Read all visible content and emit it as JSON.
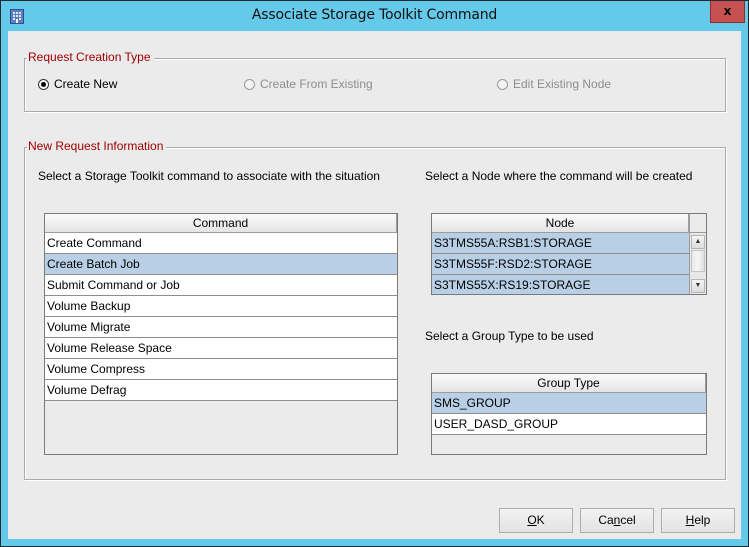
{
  "window": {
    "title": "Associate Storage Toolkit Command",
    "icon": "building-icon",
    "close_label": "x"
  },
  "request_creation_type": {
    "legend": "Request Creation Type",
    "options": [
      {
        "label": "Create New",
        "selected": true,
        "enabled": true
      },
      {
        "label": "Create From Existing",
        "selected": false,
        "enabled": false
      },
      {
        "label": "Edit Existing Node",
        "selected": false,
        "enabled": false
      }
    ]
  },
  "new_request_information": {
    "legend": "New Request Information",
    "command_prompt": "Select a Storage Toolkit command to associate with the situation",
    "node_prompt": "Select a Node where the command will be created",
    "group_prompt": "Select a Group Type to be used",
    "command_table": {
      "header": "Command",
      "rows": [
        {
          "label": "Create Command",
          "selected": false
        },
        {
          "label": "Create Batch Job",
          "selected": true
        },
        {
          "label": "Submit Command or Job",
          "selected": false
        },
        {
          "label": "Volume Backup",
          "selected": false
        },
        {
          "label": "Volume Migrate",
          "selected": false
        },
        {
          "label": "Volume Release Space",
          "selected": false
        },
        {
          "label": "Volume Compress",
          "selected": false
        },
        {
          "label": "Volume Defrag",
          "selected": false
        }
      ]
    },
    "node_table": {
      "header": "Node",
      "rows": [
        {
          "label": "S3TMS55A:RSB1:STORAGE",
          "selected": true
        },
        {
          "label": "S3TMS55F:RSD2:STORAGE",
          "selected": true
        },
        {
          "label": "S3TMS55X:RS19:STORAGE",
          "selected": true
        }
      ]
    },
    "group_table": {
      "header": "Group Type",
      "rows": [
        {
          "label": "SMS_GROUP",
          "selected": true
        },
        {
          "label": "USER_DASD_GROUP",
          "selected": false
        }
      ]
    }
  },
  "buttons": {
    "ok": {
      "pre": "",
      "mnemonic": "O",
      "post": "K"
    },
    "cancel": {
      "pre": "Ca",
      "mnemonic": "n",
      "post": "cel"
    },
    "help": {
      "pre": "",
      "mnemonic": "H",
      "post": "elp"
    }
  }
}
